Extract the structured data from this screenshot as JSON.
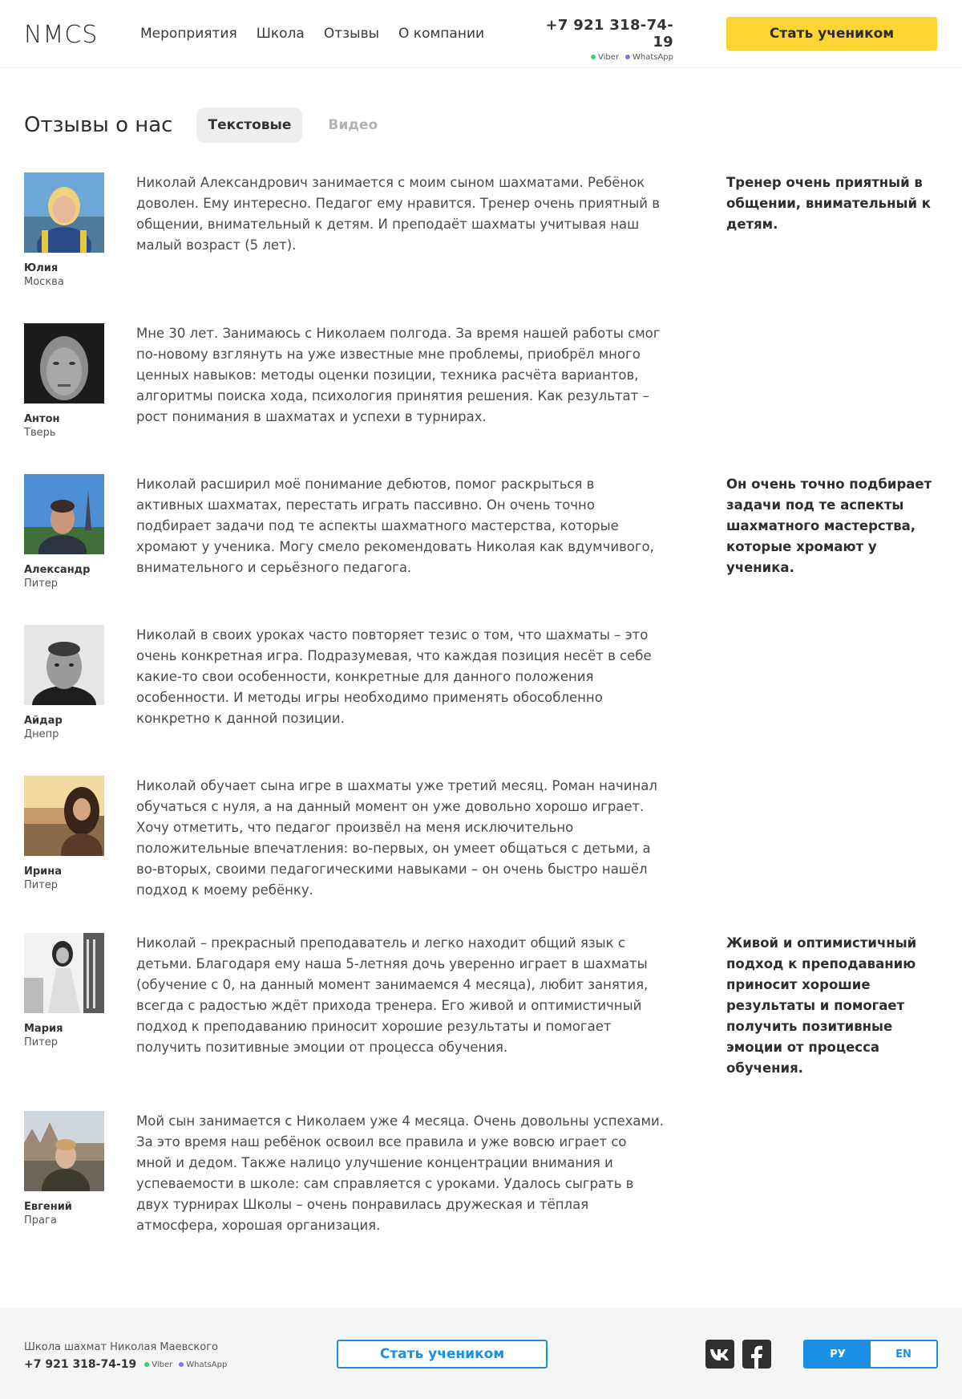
{
  "header": {
    "logo": "NMCS",
    "nav": [
      "Мероприятия",
      "Школа",
      "Отзывы",
      "О компании"
    ],
    "phone": "+7 921 318-74-19",
    "messengers": [
      "Viber",
      "WhatsApp"
    ],
    "cta": "Стать учеником"
  },
  "page": {
    "title": "Отзывы о нас",
    "tabs": [
      "Текстовые",
      "Видео"
    ],
    "active_tab": "Текстовые"
  },
  "reviews": [
    {
      "name": "Юлия",
      "city": "Москва",
      "text": "Николай Александрович занимается с моим сыном шахматами. Ребёнок доволен. Ему интересно. Педагог ему нравится. Тренер очень приятный в общении, внимательный к детям. И преподаёт шахматы учитывая наш малый возраст (5 лет).",
      "quote": "Тренер очень приятный в общении, внимательный к детям."
    },
    {
      "name": "Антон",
      "city": "Тверь",
      "text": "Мне 30 лет. Занимаюсь с Николаем полгода. За время нашей работы смог по-новому взглянуть на уже известные мне проблемы, приобрёл много ценных навыков: методы оценки позиции, техника расчёта вариантов, алгоритмы поиска хода, психология принятия решения. Как результат – рост понимания в шахматах и успехи в турнирах.",
      "quote": ""
    },
    {
      "name": "Александр",
      "city": "Питер",
      "text": "Николай расширил моё понимание дебютов, помог раскрыться в активных шахматах, перестать играть пассивно. Он очень точно подбирает задачи под те аспекты шахматного мастерства, которые хромают у ученика. Могу смело рекомендовать Николая как вдумчивого, внимательного и серьёзного педагога.",
      "quote": "Он очень точно подбирает задачи под те аспекты шахматного мастерства, которые хромают у ученика."
    },
    {
      "name": "Айдар",
      "city": "Днепр",
      "text": "Николай в своих уроках часто повторяет тезис о том, что шахматы – это очень конкретная игра. Подразумевая, что каждая позиция несёт в себе какие-то свои особенности, конкретные для данного положения особенности. И методы игры необходимо применять обособленно конкретно к данной позиции.",
      "quote": ""
    },
    {
      "name": "Ирина",
      "city": "Питер",
      "text": "Николай обучает сына игре в шахматы уже третий месяц. Роман начинал обучаться с нуля, а на данный момент он уже довольно хорошо играет. Хочу отметить, что педагог произвёл на меня исключительно положительные впечатления: во-первых, он умеет общаться с детьми, а во-вторых, своими педагогическими навыками – он очень быстро нашёл подход к моему ребёнку.",
      "quote": ""
    },
    {
      "name": "Мария",
      "city": "Питер",
      "text": "Николай – прекрасный преподаватель и легко находит общий язык с детьми. Благодаря ему наша 5-летняя дочь уверенно играет в шахматы (обучение с 0, на данный момент занимаемся 4 месяца), любит занятия, всегда с радостью ждёт прихода тренера. Его живой и оптимистичный подход к преподаванию приносит хорошие результаты и помогает получить позитивные эмоции от процесса обучения.",
      "quote": "Живой и оптимистичный подход к преподаванию приносит хорошие результаты и помогает получить позитивные эмоции от процесса обучения."
    },
    {
      "name": "Евгений",
      "city": "Прага",
      "text": "Мой сын занимается с Николаем уже 4 месяца. Очень довольны успехами. За это время наш ребёнок освоил все правила и уже вовсю играет со мной и дедом. Также налицо улучшение концентрации внимания и успеваемости в школе: сам справляется с уроками. Удалось сыграть в двух турнирах Школы – очень понравилась дружеская и тёплая атмосфера, хорошая организация.",
      "quote": ""
    }
  ],
  "footer": {
    "school": "Школа шахмат Николая Маевского",
    "phone": "+7 921 318-74-19",
    "messengers": [
      "Viber",
      "WhatsApp"
    ],
    "cta": "Стать учеником",
    "social": [
      "vk-icon",
      "facebook-icon"
    ],
    "languages": [
      "РУ",
      "EN"
    ],
    "active_language": "РУ"
  },
  "colors": {
    "accent_yellow": "#fcd535",
    "accent_blue": "#1a8fe3",
    "viber_green": "#3ccf78",
    "whatsapp_purple": "#8e6bf2"
  }
}
